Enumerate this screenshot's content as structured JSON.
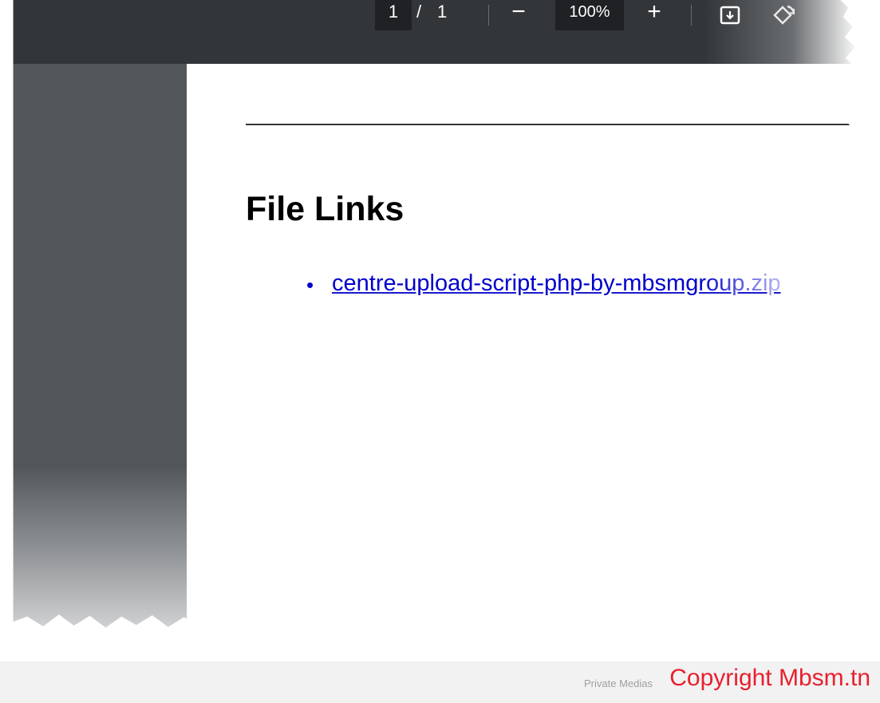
{
  "toolbar": {
    "current_page": "1",
    "page_separator": "/",
    "total_pages": "1",
    "zoom_out_label": "−",
    "zoom_level": "100%",
    "zoom_in_label": "+",
    "icons": [
      "fit-to-page-icon",
      "rotate-icon"
    ]
  },
  "document": {
    "heading": "File Links",
    "links": [
      {
        "text": "centre-upload-script-php-by-mbsmgroup.zip"
      }
    ]
  },
  "footer": {
    "private_label": "Private Medias",
    "copyright": "Copyright Mbsm.tn"
  },
  "colors": {
    "toolbar_bg": "#333639",
    "sidebar_bg": "#525659",
    "link": "#0000cc",
    "copyright": "#e8202e"
  }
}
